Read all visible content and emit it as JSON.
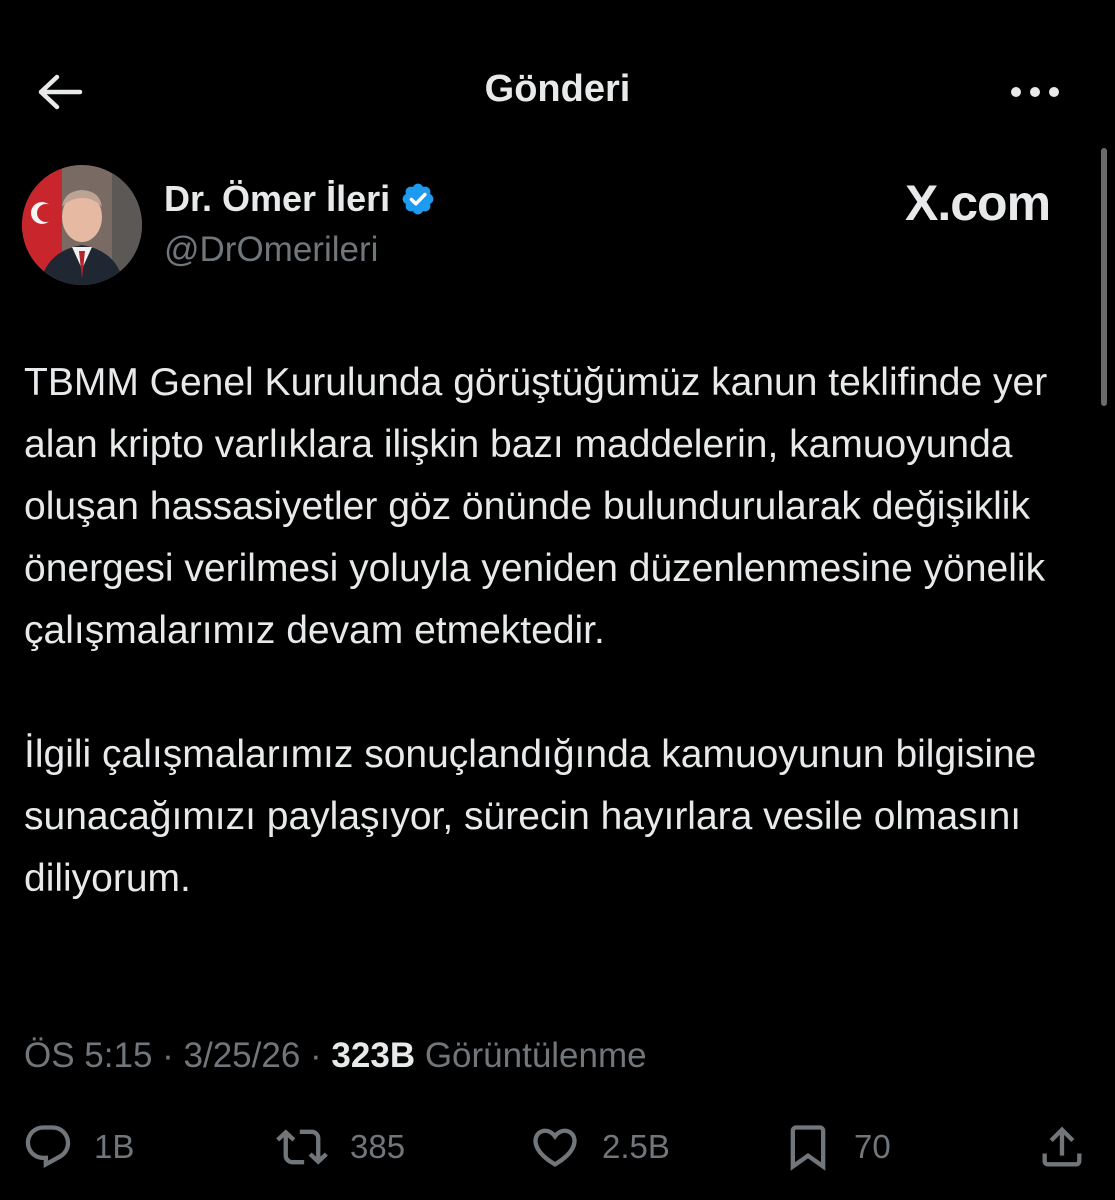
{
  "header": {
    "title": "Gönderi",
    "back_icon": "arrow-left-icon",
    "more_icon": "more-horizontal-icon"
  },
  "author": {
    "name": "Dr. Ömer İleri",
    "handle": "@DrOmerileri",
    "verified": true,
    "verified_color": "#1d9bf0"
  },
  "watermark": "X.com",
  "tweet": {
    "paragraph_1": "TBMM Genel Kurulunda görüştüğümüz kanun teklifinde yer alan kripto varlıklara ilişkin bazı maddelerin, kamuoyunda oluşan hassasiyetler göz önünde bulundurularak değişiklik önergesi verilmesi yoluyla yeniden düzenlenmesine yönelik çalışmalarımız devam etmektedir.",
    "paragraph_2": "İlgili çalışmalarımız sonuçlandığında kamuoyunun bilgisine sunacağımızı paylaşıyor, sürecin hayırlara vesile olmasını diliyorum."
  },
  "meta": {
    "time": "ÖS 5:15",
    "separator": " · ",
    "date": "3/25/26",
    "views_count": "323B",
    "views_label": " Görüntülenme"
  },
  "actions": {
    "reply": {
      "icon": "reply-icon",
      "count": "1B"
    },
    "repost": {
      "icon": "repost-icon",
      "count": "385"
    },
    "like": {
      "icon": "heart-icon",
      "count": "2.5B"
    },
    "bookmark": {
      "icon": "bookmark-icon",
      "count": "70"
    },
    "share": {
      "icon": "share-icon"
    }
  },
  "colors": {
    "background": "#000000",
    "text_primary": "#e7e9ea",
    "text_secondary": "#71767b",
    "accent": "#1d9bf0"
  }
}
